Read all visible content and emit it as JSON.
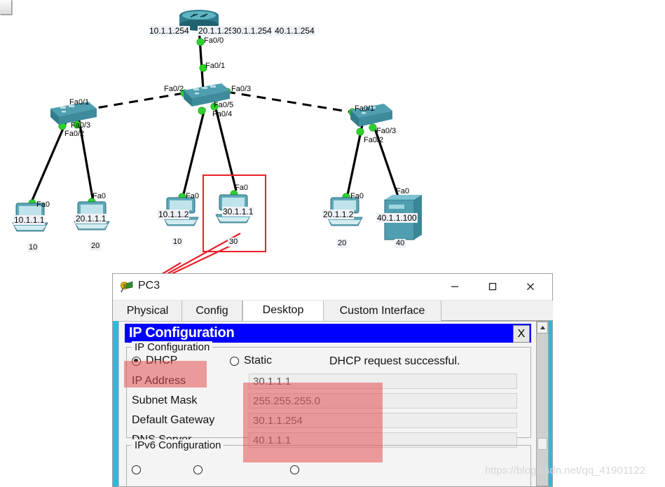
{
  "topology": {
    "router": {
      "name": "router",
      "ips": [
        "10.1.1.254",
        "20.1.1.254",
        "30.1.1.254",
        "40.1.1.254"
      ],
      "ports": [
        "Fa0/0"
      ]
    },
    "switches": [
      {
        "id": "switch-left",
        "ports": [
          "Fa0/1",
          "Fa0/2",
          "Fa0/3"
        ]
      },
      {
        "id": "switch-center",
        "ports": [
          "Fa0/1",
          "Fa0/2",
          "Fa0/3",
          "Fa0/4",
          "Fa0/5"
        ]
      },
      {
        "id": "switch-right",
        "ports": [
          "Fa0/1",
          "Fa0/2",
          "Fa0/3"
        ]
      }
    ],
    "endpoints": [
      {
        "ip": "10.1.1.1",
        "vlan": "10",
        "port": "Fa0",
        "kind": "pc"
      },
      {
        "ip": "20.1.1.1",
        "vlan": "20",
        "port": "Fa0",
        "kind": "pc"
      },
      {
        "ip": "10.1.1.2",
        "vlan": "10",
        "port": "Fa0",
        "kind": "pc"
      },
      {
        "ip": "30.1.1.1",
        "vlan": "30",
        "port": "Fa0",
        "kind": "pc"
      },
      {
        "ip": "20.1.1.2",
        "vlan": "20",
        "port": "Fa0",
        "kind": "pc"
      },
      {
        "ip": "40.1.1.100",
        "vlan": "40",
        "port": "Fa0",
        "kind": "server"
      }
    ],
    "annotation": {
      "highlight_color": "#e8202a",
      "arrow_color": "#e8202a"
    }
  },
  "window": {
    "title": "PC3",
    "icon": "packet-tracer-icon",
    "buttons": {
      "minimize": "—",
      "maximize": "□",
      "close": "✕"
    },
    "tabs": [
      {
        "label": "Physical",
        "active": false
      },
      {
        "label": "Config",
        "active": false
      },
      {
        "label": "Desktop",
        "active": true
      },
      {
        "label": "Custom Interface",
        "active": false
      }
    ]
  },
  "ip_configuration": {
    "panel_title": "IP Configuration",
    "panel_close": "X",
    "group_legend": "IP Configuration",
    "mode": {
      "dhcp_label": "DHCP",
      "dhcp_selected": true,
      "static_label": "Static",
      "static_selected": false
    },
    "status_message": "DHCP request successful.",
    "fields": [
      {
        "label": "IP Address",
        "value": "30.1.1.1"
      },
      {
        "label": "Subnet Mask",
        "value": "255.255.255.0"
      },
      {
        "label": "Default Gateway",
        "value": "30.1.1.254"
      },
      {
        "label": "DNS Server",
        "value": "40.1.1.1"
      }
    ],
    "ipv6_legend": "IPv6 Configuration"
  },
  "scrollbar": {
    "up_arrow": "▲"
  },
  "watermark": "https://blog.csdn.net/qq_41901122"
}
